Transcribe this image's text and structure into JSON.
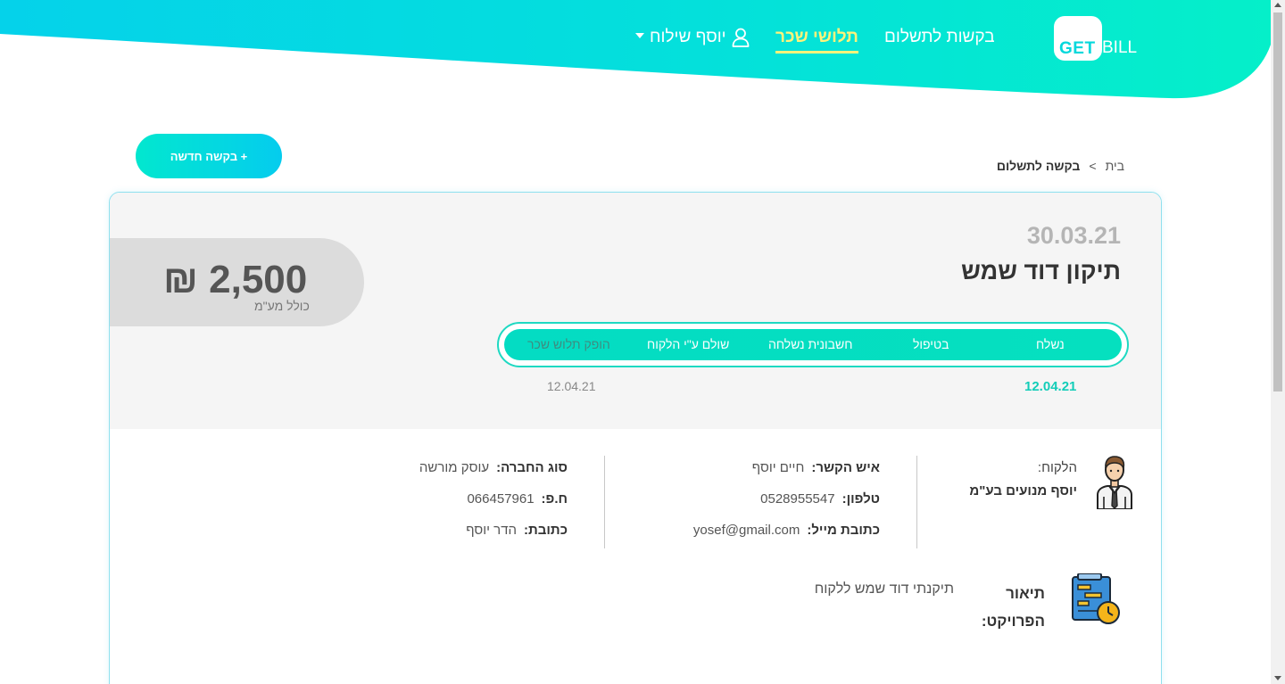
{
  "header": {
    "logo_get": "GET",
    "logo_bill": "BILL",
    "nav": {
      "requests": "בקשות לתשלום",
      "payslips": "תלושי שכר",
      "user": "יוסף שילוח"
    }
  },
  "colors": {
    "accent": "#04dcc3",
    "accent_cyan": "#05ccee",
    "highlight": "#fff37a"
  },
  "actions": {
    "new_request": "+ בקשה חדשה"
  },
  "breadcrumb": {
    "home": "בית",
    "separator": ">",
    "current": "בקשה לתשלום"
  },
  "request": {
    "date": "30.03.21",
    "title": "תיקון דוד שמש",
    "amount": "2,500 ₪",
    "amount_note": "כולל מע\"מ",
    "steps": [
      {
        "label": "נשלח"
      },
      {
        "label": "בטיפול"
      },
      {
        "label": "חשבונית נשלחה"
      },
      {
        "label": "שולם ע\"י הלקוח"
      },
      {
        "label": "הופק תלוש שכר"
      }
    ],
    "step_dates": {
      "first": "12.04.21",
      "last": "12.04.21"
    }
  },
  "client": {
    "label": "הלקוח:",
    "name": "יוסף מנועים בע\"מ",
    "contact_label": "איש הקשר:",
    "contact_value": "חיים יוסף",
    "phone_label": "טלפון:",
    "phone_value": "0528955547",
    "email_label": "כתובת מייל:",
    "email_value": "yosef@gmail.com",
    "company_type_label": "סוג החברה:",
    "company_type_value": "עוסק מורשה",
    "company_id_label": "ח.פ:",
    "company_id_value": "066457961",
    "address_label": "כתובת:",
    "address_value": "הדר יוסף"
  },
  "project": {
    "label": "תיאור הפרויקט:",
    "description": "תיקנתי דוד שמש ללקוח"
  }
}
